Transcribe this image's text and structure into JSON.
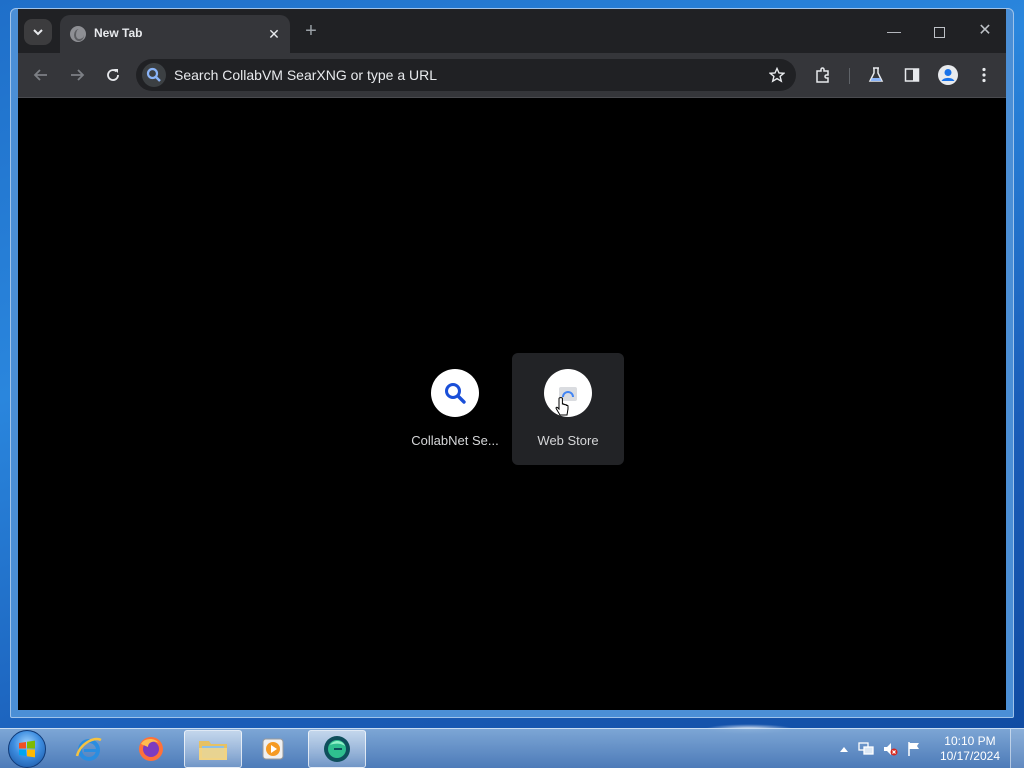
{
  "browser": {
    "tab": {
      "title": "New Tab",
      "close_glyph": "✕"
    },
    "new_tab_glyph": "+",
    "window_controls": {
      "minimize_glyph": "—",
      "close_glyph": "✕"
    }
  },
  "toolbar": {
    "omnibox": {
      "placeholder": "Search CollabVM SearXNG or type a URL",
      "value": ""
    }
  },
  "new_tab_page": {
    "shortcuts": [
      {
        "label": "CollabNet Se...",
        "icon": "search-icon"
      },
      {
        "label": "Web Store",
        "icon": "web-store-icon"
      }
    ]
  },
  "taskbar": {
    "pinned": [
      {
        "name": "internet-explorer",
        "icon": "ie-icon"
      },
      {
        "name": "firefox",
        "icon": "firefox-icon"
      },
      {
        "name": "windows-explorer",
        "icon": "folder-icon"
      },
      {
        "name": "media-player",
        "icon": "media-player-icon"
      },
      {
        "name": "chrome",
        "icon": "browser-icon"
      }
    ],
    "clock": {
      "time": "10:10 PM",
      "date": "10/17/2024"
    }
  },
  "colors": {
    "accent": "#8ab4f8",
    "frame": "#202124",
    "toolbar": "#35363a",
    "content": "#000000"
  }
}
